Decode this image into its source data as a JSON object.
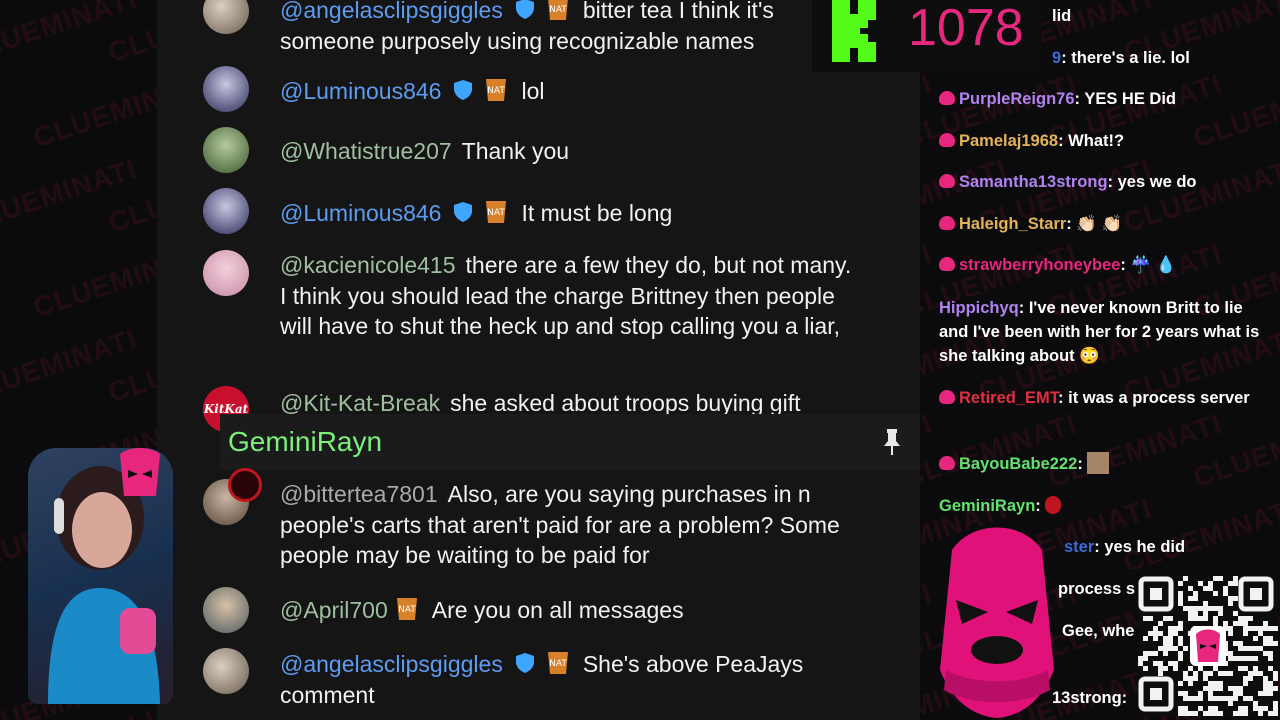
{
  "watermark": "CLUEMINATI",
  "colors": {
    "accent_pink": "#e6277d",
    "kick_green": "#53fc18",
    "pin_green": "#7cf07a"
  },
  "yt_chat": {
    "messages": [
      {
        "author": "@angelasclipsgiggles",
        "mod": true,
        "nat": true,
        "text": "bitter tea I think it's someone purposely using recognizable names"
      },
      {
        "author": "@Luminous846",
        "mod": true,
        "nat": true,
        "text": "lol"
      },
      {
        "author": "@Whatistrue207",
        "mod": false,
        "nat": false,
        "text": "Thank you"
      },
      {
        "author": "@Luminous846",
        "mod": true,
        "nat": true,
        "text": "It must be long"
      },
      {
        "author": "@kacienicole415",
        "mod": false,
        "nat": false,
        "text": "there are a few they do, but not many. I think you should lead the charge Brittney then people will have to shut the heck up and stop calling you a liar,"
      },
      {
        "author": "@Kit-Kat-Break",
        "mod": false,
        "nat": false,
        "text": "she asked about troops buying gift"
      },
      {
        "author": "@bittertea7801",
        "mod": false,
        "nat": false,
        "text": "Also, are you saying purchases in n people's carts that aren't paid for are a problem? Some people may be waiting to be paid for"
      },
      {
        "author": "@April700",
        "mod": false,
        "nat": true,
        "text": "Are you on all messages"
      },
      {
        "author": "@angelasclipsgiggles",
        "mod": true,
        "nat": true,
        "text": "She's above PeaJays comment"
      }
    ],
    "pinned": {
      "name": "GeminiRayn",
      "icon": "pin-icon"
    },
    "avatar_labels": {
      "kitkat": "KitKat"
    }
  },
  "kick": {
    "count": "1078",
    "logo_letter": "K"
  },
  "twitch_chat": {
    "lines": [
      {
        "name": "",
        "text": "lid"
      },
      {
        "name": "9",
        "text": ": there's a lie. lol"
      },
      {
        "name": "PurpleReign76",
        "text": ": YES HE Did"
      },
      {
        "name": "Pamelaj1968",
        "text": ": What!?"
      },
      {
        "name": "Samantha13strong",
        "text": ": yes we do"
      },
      {
        "name": "Haleigh_Starr",
        "text": ": 👏🏻 👏🏻"
      },
      {
        "name": "strawberryhoneybee",
        "text": ": ☔ 💧"
      },
      {
        "name": "Hippichyq",
        "text": ": I've never known Britt to lie and I've been with her for 2 years what is she talking about 😳"
      },
      {
        "name": "Retired_EMT",
        "text": ": it was a process server"
      },
      {
        "name": "BayouBabe222",
        "text": ":"
      },
      {
        "name": "GeminiRayn",
        "text": ":"
      },
      {
        "name": "ster",
        "text": ": yes he did"
      },
      {
        "name": "",
        "text": "process s"
      },
      {
        "name": "",
        "text": "Gee, whe"
      },
      {
        "name": "",
        "text": "13strong:"
      }
    ]
  }
}
